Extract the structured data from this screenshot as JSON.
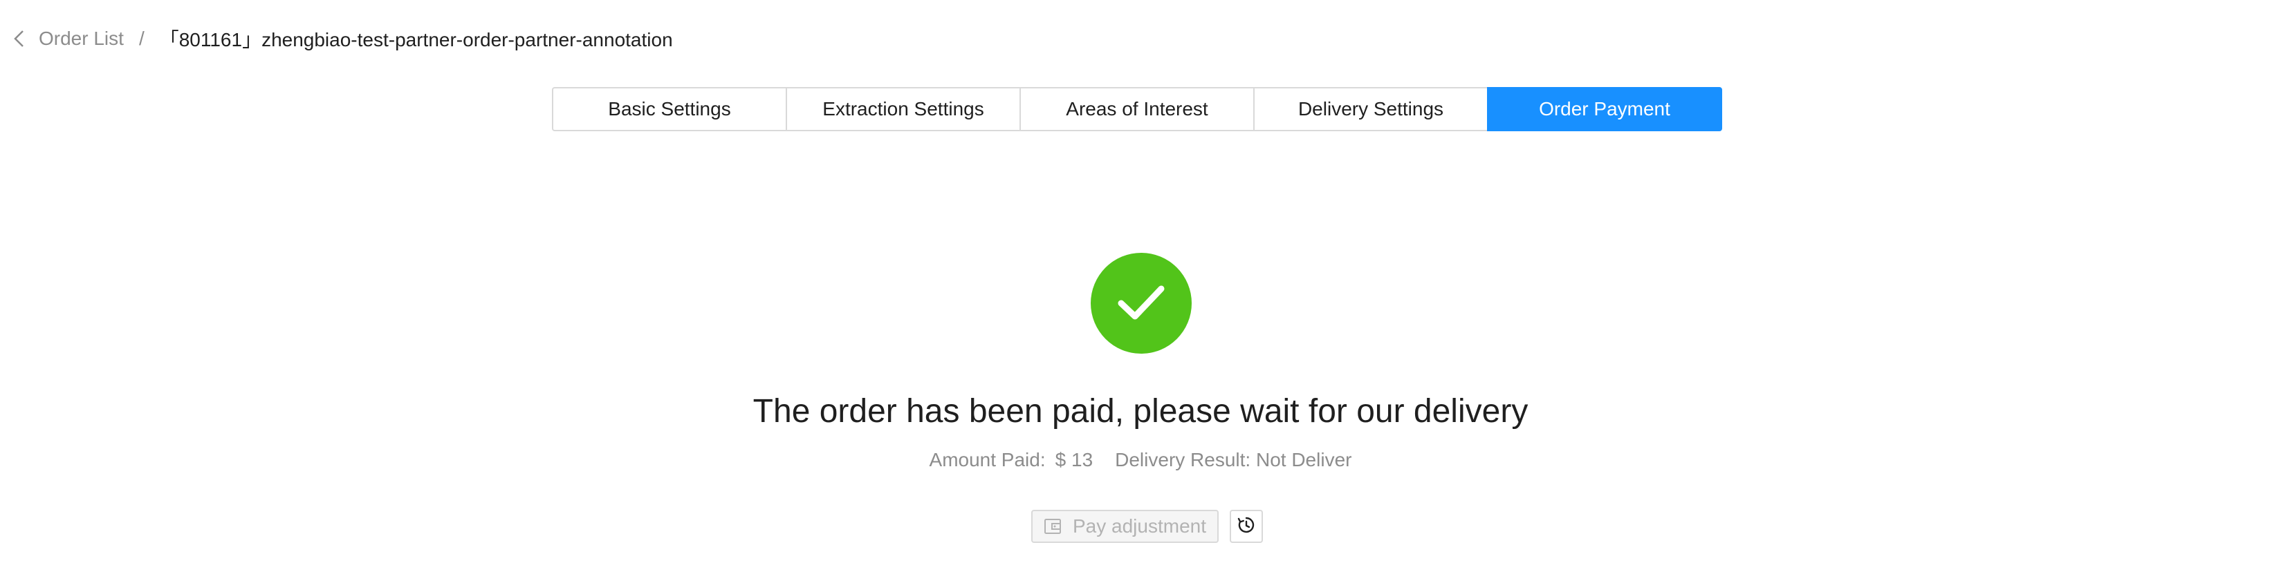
{
  "breadcrumb": {
    "back_icon": "chevron-left-icon",
    "parent": "Order List",
    "separator": "/",
    "current": "「801161」zhengbiao-test-partner-order-partner-annotation"
  },
  "tabs": [
    {
      "label": "Basic Settings",
      "active": false
    },
    {
      "label": "Extraction Settings",
      "active": false
    },
    {
      "label": "Areas of Interest",
      "active": false
    },
    {
      "label": "Delivery Settings",
      "active": false
    },
    {
      "label": "Order Payment",
      "active": true
    }
  ],
  "result": {
    "status_icon": "check-circle-icon",
    "title": "The order has been paid, please wait for our delivery",
    "amount_label": "Amount Paid:",
    "amount_value": "$ 13",
    "delivery_label": "Delivery Result:",
    "delivery_value": "Not Deliver"
  },
  "actions": {
    "pay_adjustment_label": "Pay adjustment",
    "pay_adjustment_icon": "wallet-icon",
    "history_icon": "history-icon"
  },
  "colors": {
    "accent": "#1890ff",
    "success": "#52c41a",
    "muted_text": "#8c8c8c",
    "border": "#d9d9d9"
  }
}
